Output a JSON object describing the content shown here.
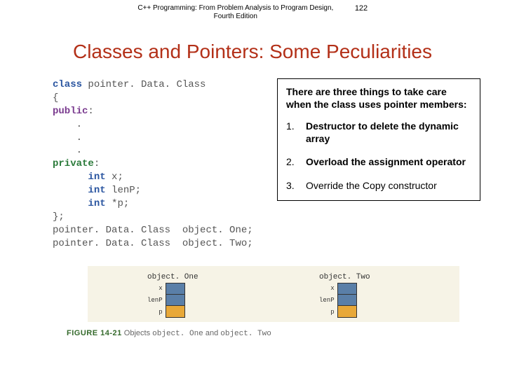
{
  "header": {
    "title": "C++ Programming: From Problem Analysis to Program Design, Fourth Edition",
    "page": "122"
  },
  "title": "Classes and Pointers: Some Peculiarities",
  "code": {
    "kw_class": "class",
    "class_name": " pointer. Data. Class",
    "brace_open": "{",
    "kw_public": "public",
    "colon1": ":",
    "dot1": "    .",
    "dot2": "    .",
    "dot3": "    .",
    "kw_private": "private",
    "colon2": ":",
    "kw_int1": "int",
    "decl_x": " x;",
    "kw_int2": "int",
    "decl_lenP": " lenP;",
    "kw_int3": "int",
    "decl_p": " *p;",
    "brace_close": "};",
    "inst1_type": "pointer. Data. Class",
    "inst1_name": "  object. One;",
    "inst2_type": "pointer. Data. Class",
    "inst2_name": "  object. Two;"
  },
  "callout": {
    "intro": "There are three things to take care when the class uses pointer members:",
    "items": [
      {
        "num": "1.",
        "text": "Destructor to delete the dynamic array"
      },
      {
        "num": "2.",
        "text": "Overload the assignment operator"
      },
      {
        "num": "3.",
        "text": "Override the Copy constructor"
      }
    ]
  },
  "diagram": {
    "obj1_label": "object. One",
    "obj2_label": "object. Two",
    "fields": {
      "x": "x",
      "lenP": "lenP",
      "p": "p"
    }
  },
  "figure": {
    "label": "FIGURE 14-21",
    "text_a": "  Objects ",
    "obj1": "object. One",
    "and": " and ",
    "obj2": "object. Two"
  }
}
